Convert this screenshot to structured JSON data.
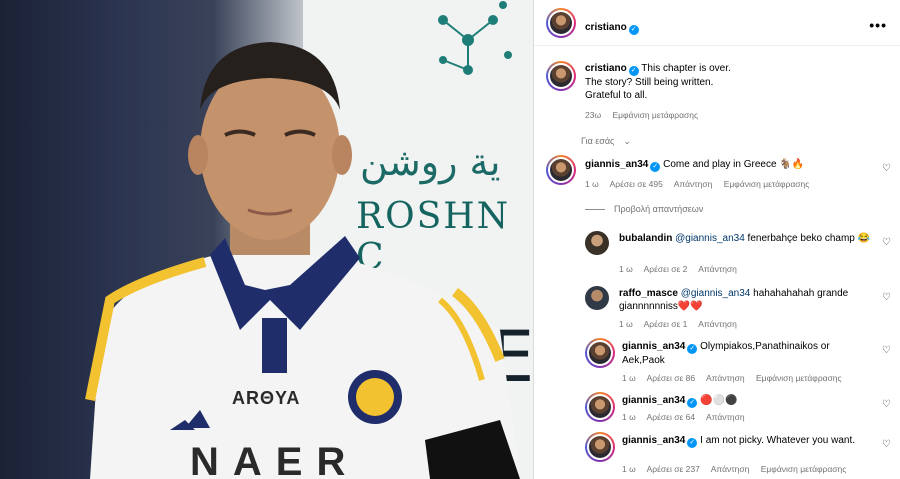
{
  "post": {
    "username": "cristiano",
    "caption_lines": [
      "This chapter is over.",
      "The story? Still being written.",
      "Grateful to all."
    ],
    "time": "23ω",
    "translate": "Εμφάνιση μετάφρασης"
  },
  "photo": {
    "arabic_text": "ية روشن",
    "sponsor_text": "ROSHN C",
    "jersey_brand": "ARΘYA",
    "jersey_word": "NAER"
  },
  "for_you": "Για εσάς",
  "comments": [
    {
      "username": "giannis_an34",
      "text": "Come and play in Greece 🐐🔥",
      "time": "1 ω",
      "likes": "Αρέσει σε 495",
      "reply": "Απάντηση",
      "translate": "Εμφάνιση μετάφρασης"
    }
  ],
  "view_replies": "Προβολή απαντήσεων",
  "replies": [
    {
      "username": "bubalandin",
      "mention": "@giannis_an34",
      "text": " fenerbahçe beko champ 😂",
      "time": "1 ω",
      "likes": "Αρέσει σε 2",
      "reply": "Απάντηση"
    },
    {
      "username": "raffo_masce",
      "mention": "@giannis_an34",
      "text": " hahahahahah grande giannnnnniss❤️❤️",
      "time": "1 ω",
      "likes": "Αρέσει σε 1",
      "reply": "Απάντηση"
    }
  ],
  "thread": [
    {
      "username": "giannis_an34",
      "text": "Olympiakos,Panathinaikos or Aek,Paok",
      "time": "1 ω",
      "likes": "Αρέσει σε 86",
      "reply": "Απάντηση",
      "translate": "Εμφάνιση μετάφρασης"
    },
    {
      "username": "giannis_an34",
      "text": "🔴⚪⚫",
      "time": "1 ω",
      "likes": "Αρέσει σε 64",
      "reply": "Απάντηση"
    },
    {
      "username": "giannis_an34",
      "text": "I am not picky. Whatever you want.",
      "time": "1 ω",
      "likes": "Αρέσει σε 237",
      "reply": "Απάντηση",
      "translate": "Εμφάνιση μετάφρασης"
    }
  ],
  "colors": {
    "accent": "#0095f6",
    "meta": "#737373",
    "mention": "#00376b",
    "roshn": "#156460"
  },
  "icons": {
    "more": "more-dots-icon",
    "like": "heart-icon",
    "verified": "verified-badge-icon"
  }
}
